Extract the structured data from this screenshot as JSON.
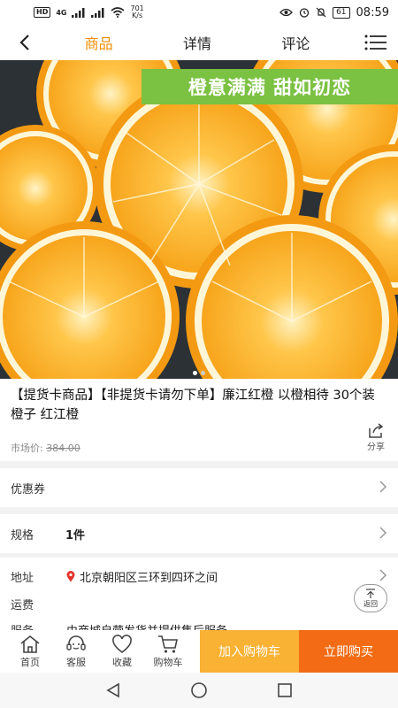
{
  "status_bar": {
    "hd": "HD",
    "network": "4G",
    "speed_value": "701",
    "speed_unit": "K/s",
    "battery": "61",
    "time": "08:59"
  },
  "nav": {
    "tabs": [
      "商品",
      "详情",
      "评论"
    ],
    "active_tab": 0
  },
  "hero": {
    "banner": "橙意满满  甜如初恋",
    "slide_count": 2,
    "active_slide": 0
  },
  "product": {
    "title": "【提货卡商品】【非提货卡请勿下单】廉江红橙 以橙相待 30个装 橙子 红江橙",
    "market_price_label": "市场价:",
    "market_price": "384.00",
    "share_label": "分享"
  },
  "rows": {
    "coupon_label": "优惠券",
    "spec_label": "规格",
    "spec_value": "1件",
    "address_label": "地址",
    "address_value": "北京朝阳区三环到四环之间",
    "shipping_label": "运费",
    "service_label": "服务",
    "service_value": "由商城自营发货并提供售后服务"
  },
  "back_top_label": "返回",
  "bottom_bar": {
    "items": [
      {
        "label": "首页",
        "icon": "home-icon"
      },
      {
        "label": "客服",
        "icon": "customer-service-icon"
      },
      {
        "label": "收藏",
        "icon": "heart-icon"
      },
      {
        "label": "购物车",
        "icon": "cart-icon"
      }
    ],
    "add_to_cart": "加入购物车",
    "buy_now": "立即购买"
  },
  "colors": {
    "accent": "#f08c00",
    "cart_button": "#f9b233",
    "buy_button": "#f36c15",
    "banner": "#7bc142"
  }
}
